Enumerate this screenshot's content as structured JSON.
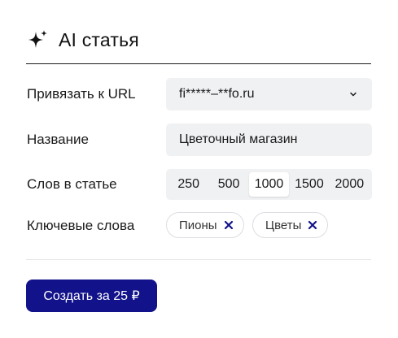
{
  "header": {
    "title": "AI статья",
    "icon": "sparkle-icon"
  },
  "form": {
    "url": {
      "label": "Привязать к URL",
      "value": "fi*****–**fo.ru",
      "icon": "chevron-down-icon"
    },
    "name": {
      "label": "Название",
      "value": "Цветочный магазин"
    },
    "words": {
      "label": "Слов в статье",
      "options": [
        "250",
        "500",
        "1000",
        "1500",
        "2000"
      ],
      "selected": "1000"
    },
    "keywords": {
      "label": "Ключевые слова",
      "chips": [
        "Пионы",
        "Цветы"
      ],
      "remove_icon": "close-icon"
    }
  },
  "submit": {
    "label": "Создать за 25 ₽"
  },
  "colors": {
    "accent": "#12128a",
    "field_bg": "#f0f1f3",
    "chip_x": "#12128a"
  }
}
